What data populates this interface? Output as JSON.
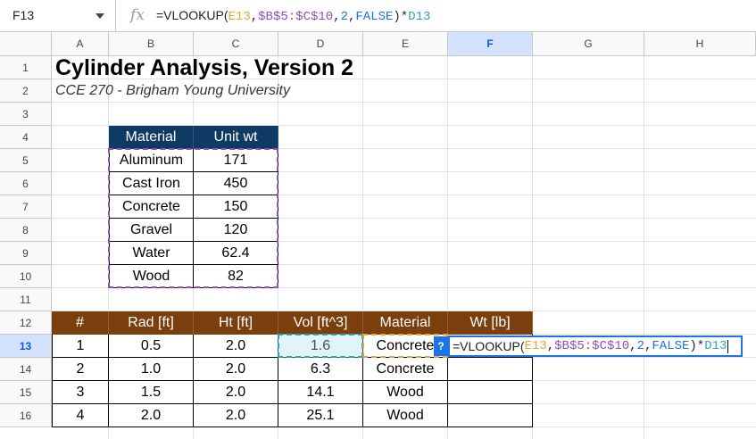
{
  "name_box": {
    "ref": "F13"
  },
  "formula": {
    "prefix": "=VLOOKUP(",
    "arg1": "E13",
    "comma1": ",",
    "arg2": "$B$5:$C$10",
    "comma2": ",",
    "arg3": "2",
    "comma3": ",",
    "arg4": "FALSE",
    "close": ")*",
    "arg5": "D13"
  },
  "columns": [
    "A",
    "B",
    "C",
    "D",
    "E",
    "F",
    "G",
    "H"
  ],
  "selected_column": "F",
  "rows": [
    "1",
    "2",
    "3",
    "4",
    "5",
    "6",
    "7",
    "8",
    "9",
    "10",
    "11",
    "12",
    "13",
    "14",
    "15",
    "16"
  ],
  "selected_row": "13",
  "title": "Cylinder Analysis, Version 2",
  "subtitle": "CCE 270 - Brigham Young University",
  "unit_table": {
    "headers": [
      "Material",
      "Unit wt"
    ],
    "rows": [
      [
        "Aluminum",
        "171"
      ],
      [
        "Cast Iron",
        "450"
      ],
      [
        "Concrete",
        "150"
      ],
      [
        "Gravel",
        "120"
      ],
      [
        "Water",
        "62.4"
      ],
      [
        "Wood",
        "82"
      ]
    ]
  },
  "cyl_table": {
    "headers": [
      "#",
      "Rad [ft]",
      "Ht [ft]",
      "Vol [ft^3]",
      "Material",
      "Wt [lb]"
    ],
    "rows": [
      [
        "1",
        "0.5",
        "2.0",
        "1.6",
        "Concrete",
        ""
      ],
      [
        "2",
        "1.0",
        "2.0",
        "6.3",
        "Concrete",
        ""
      ],
      [
        "3",
        "1.5",
        "2.0",
        "14.1",
        "Wood",
        ""
      ],
      [
        "4",
        "2.0",
        "2.0",
        "25.1",
        "Wood",
        ""
      ]
    ]
  },
  "help_badge": "?",
  "colors": {
    "unit_header_bg": "#0f3a63",
    "cyl_header_bg": "#7a3f0d",
    "ref_orange": "#e8a33a",
    "ref_purple": "#8e4fb8",
    "ref_teal": "#2aa5b8",
    "accent_blue": "#1a73e8"
  },
  "icons": [
    "fx-icon",
    "dropdown-caret-icon"
  ]
}
